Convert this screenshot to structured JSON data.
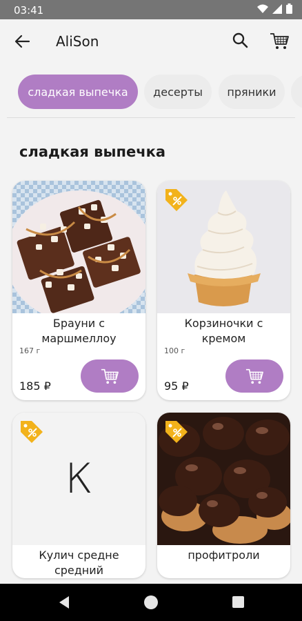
{
  "status_bar": {
    "time": "03:41",
    "icons": [
      "wifi-icon",
      "signal-icon",
      "battery-icon"
    ]
  },
  "app_bar": {
    "title": "AliSon"
  },
  "categories": [
    {
      "label": "сладкая выпечка",
      "active": true
    },
    {
      "label": "десерты",
      "active": false
    },
    {
      "label": "пряники",
      "active": false
    },
    {
      "label": "",
      "active": false
    }
  ],
  "section": {
    "title": "сладкая выпечка"
  },
  "products": [
    {
      "name": "Брауни с маршмеллоу",
      "weight": "167 г",
      "price": "185 ₽",
      "sale": false
    },
    {
      "name": "Корзиночки с кремом",
      "weight": "100 г",
      "price": "95 ₽",
      "sale": true
    },
    {
      "name": "Кулич средне средний",
      "placeholder_letter": "К",
      "sale": true
    },
    {
      "name": "профитроли",
      "sale": true
    }
  ],
  "colors": {
    "accent": "#b07dc4",
    "sale_tag": "#f2b21b",
    "background": "#f3f3f3"
  }
}
